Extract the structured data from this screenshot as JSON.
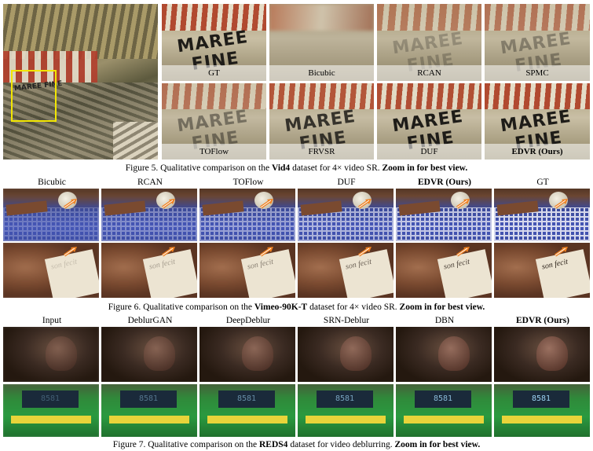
{
  "fig5": {
    "caption_prefix": "Figure 5. Qualitative comparison on the ",
    "caption_dataset": "Vid4",
    "caption_mid": " dataset for 4× video SR. ",
    "caption_emph": "Zoom in for best view.",
    "crop_text": "MAREE FINE",
    "overview_text": "MAREE FINE",
    "labels": [
      "GT",
      "Bicubic",
      "RCAN",
      "SPMC",
      "TOFlow",
      "FRVSR",
      "DUF",
      "EDVR (Ours)"
    ]
  },
  "fig6": {
    "caption_prefix": "Figure 6. Qualitative comparison on the ",
    "caption_dataset": "Vimeo-90K-T",
    "caption_mid": " dataset for 4× video SR. ",
    "caption_emph": "Zoom in for best view.",
    "labels": [
      "Bicubic",
      "RCAN",
      "TOFlow",
      "DUF",
      "EDVR (Ours)",
      "GT"
    ],
    "card_text": "son fecit"
  },
  "fig7": {
    "caption_prefix": "Figure 7. Qualitative comparison on the ",
    "caption_dataset": "REDS4",
    "caption_mid": " dataset for video deblurring. ",
    "caption_emph": "Zoom in for best view.",
    "labels": [
      "Input",
      "DeblurGAN",
      "DeepDeblur",
      "SRN-Deblur",
      "DBN",
      "EDVR (Ours)"
    ],
    "bus_text": "8581"
  }
}
